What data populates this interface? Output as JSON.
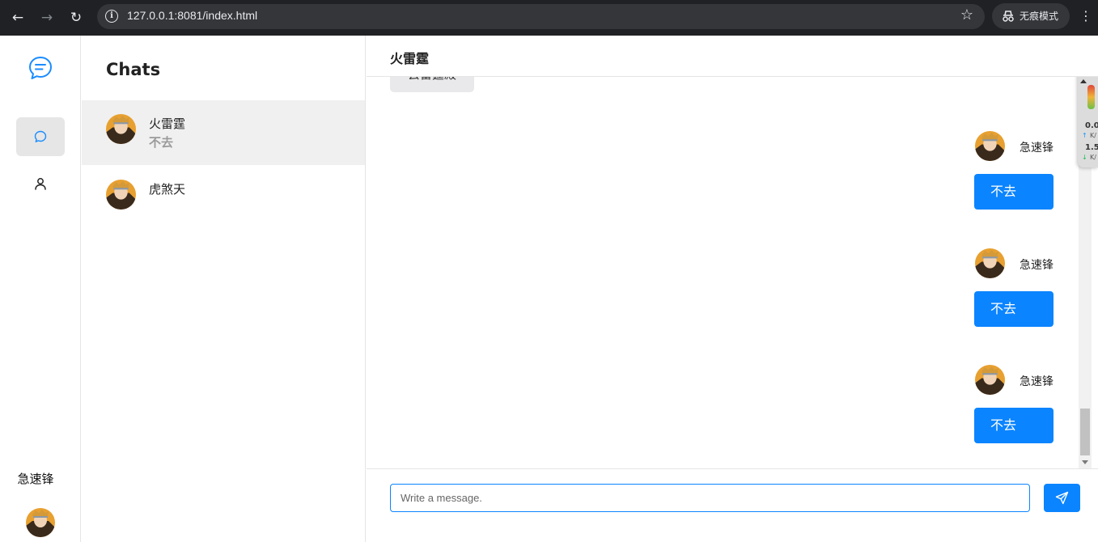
{
  "browser": {
    "url": "127.0.0.1:8081/index.html",
    "incognito_label": "无痕模式"
  },
  "rail": {
    "current_user": "急速锋"
  },
  "chat_list": {
    "title": "Chats",
    "items": [
      {
        "name": "火雷霆",
        "preview": "不去",
        "selected": true
      },
      {
        "name": "虎煞天",
        "preview": "",
        "selected": false
      }
    ]
  },
  "conversation": {
    "title": "火雷霆",
    "received_partial": "去雷霆殿",
    "messages": [
      {
        "sender": "急速锋",
        "text": "不去"
      },
      {
        "sender": "急速锋",
        "text": "不去"
      },
      {
        "sender": "急速锋",
        "text": "不去"
      }
    ],
    "input_placeholder": "Write a message."
  },
  "net_monitor": {
    "up_value": "0.0",
    "up_unit": "K/",
    "down_value": "1.5",
    "down_unit": "K/"
  },
  "colors": {
    "accent": "#0b84ff",
    "chrome": "#202124"
  }
}
